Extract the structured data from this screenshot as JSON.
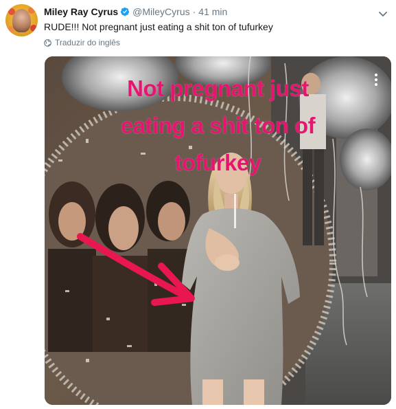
{
  "tweet": {
    "display_name": "Miley Ray Cyrus",
    "handle": "@MileyCyrus",
    "separator": "·",
    "time": "41 min",
    "text": "RUDE!!! Not pregnant just eating a shit ton of tufurkey",
    "translate_label": "Traduzir do inglês"
  },
  "media": {
    "overlay_lines": [
      "Not pregnant just",
      "eating a shit ton of",
      "tofurkey"
    ],
    "overlay_color": "#e5166f",
    "arrow_color": "#e8174f"
  },
  "icons": {
    "verified": "verified-badge-icon",
    "caret": "chevron-down-icon",
    "globe": "globe-icon",
    "menu": "vertical-dots-icon"
  },
  "colors": {
    "verified_blue": "#1da1f2",
    "secondary_text": "#657786",
    "primary_text": "#14171a"
  }
}
